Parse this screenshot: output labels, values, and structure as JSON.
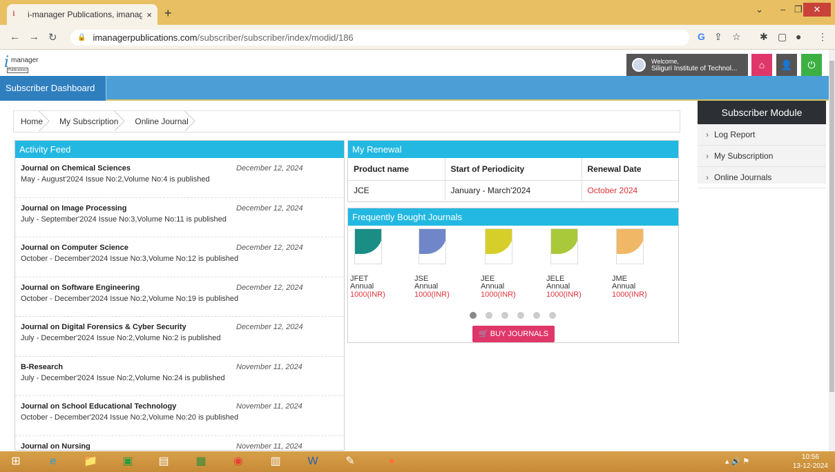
{
  "browser": {
    "tab_title": "i-manager Publications, imanage",
    "tab_close": "×",
    "new_tab": "+",
    "url_host": "imanagerpublications.com",
    "url_path": "/subscriber/subscriber/index/modid/186"
  },
  "header": {
    "logo_text": "manager",
    "logo_sub": "Publications",
    "welcome": "Welcome,",
    "institute": "Siliguri Institute of Technol..."
  },
  "subnav": {
    "dashboard": "Subscriber Dashboard"
  },
  "breadcrumb": [
    "Home",
    "My Subscription",
    "Online Journal"
  ],
  "activity": {
    "title": "Activity Feed",
    "items": [
      {
        "title": "Journal on Chemical Sciences",
        "date": "December 12, 2024",
        "desc": "May - August'2024 Issue No:2,Volume No:4 is published"
      },
      {
        "title": "Journal on Image Processing",
        "date": "December 12, 2024",
        "desc": "July - September'2024 Issue No:3,Volume No:11 is published"
      },
      {
        "title": "Journal on Computer Science",
        "date": "December 12, 2024",
        "desc": "October - December'2024 Issue No:3,Volume No:12 is published"
      },
      {
        "title": "Journal on Software Engineering",
        "date": "December 12, 2024",
        "desc": "October - December'2024 Issue No:2,Volume No:19 is published"
      },
      {
        "title": "Journal on Digital Forensics & Cyber Security",
        "date": "December 12, 2024",
        "desc": "July - December'2024 Issue No:2,Volume No:2 is published"
      },
      {
        "title": "B-Research",
        "date": "November 11, 2024",
        "desc": "July - December'2024 Issue No:2,Volume No:24 is published"
      },
      {
        "title": "Journal on School Educational Technology",
        "date": "November 11, 2024",
        "desc": "October - December'2024 Issue No:2,Volume No:20 is published"
      },
      {
        "title": "Journal on Nursing",
        "date": "November 11, 2024",
        "desc": ""
      }
    ]
  },
  "renewal": {
    "title": "My Renewal",
    "headers": [
      "Product name",
      "Start of Periodicity",
      "Renewal Date"
    ],
    "row": {
      "product": "JCE",
      "start": "January - March'2024",
      "renewal": "October 2024"
    }
  },
  "frequently_bought": {
    "title": "Frequently Bought Journals",
    "journals": [
      {
        "name": "JFET",
        "type": "Annual",
        "price": "1000(INR)",
        "color": "#1a8d85"
      },
      {
        "name": "JSE",
        "type": "Annual",
        "price": "1000(INR)",
        "color": "#6f86c8"
      },
      {
        "name": "JEE",
        "type": "Annual",
        "price": "1000(INR)",
        "color": "#d6cf2a"
      },
      {
        "name": "JELE",
        "type": "Annual",
        "price": "1000(INR)",
        "color": "#a9c93a"
      },
      {
        "name": "JME",
        "type": "Annual",
        "price": "1000(INR)",
        "color": "#f0b866"
      }
    ],
    "buy_label": "BUY JOURNALS"
  },
  "sidebar": {
    "title": "Subscriber Module",
    "items": [
      "Log Report",
      "My Subscription",
      "Online Journals"
    ]
  },
  "taskbar": {
    "time": "10:56",
    "date": "13-12-2024"
  },
  "colors": {
    "accent": "#23b8e2",
    "nav": "#4b9fd6",
    "red": "#e0323a",
    "buy": "#e0376b"
  }
}
